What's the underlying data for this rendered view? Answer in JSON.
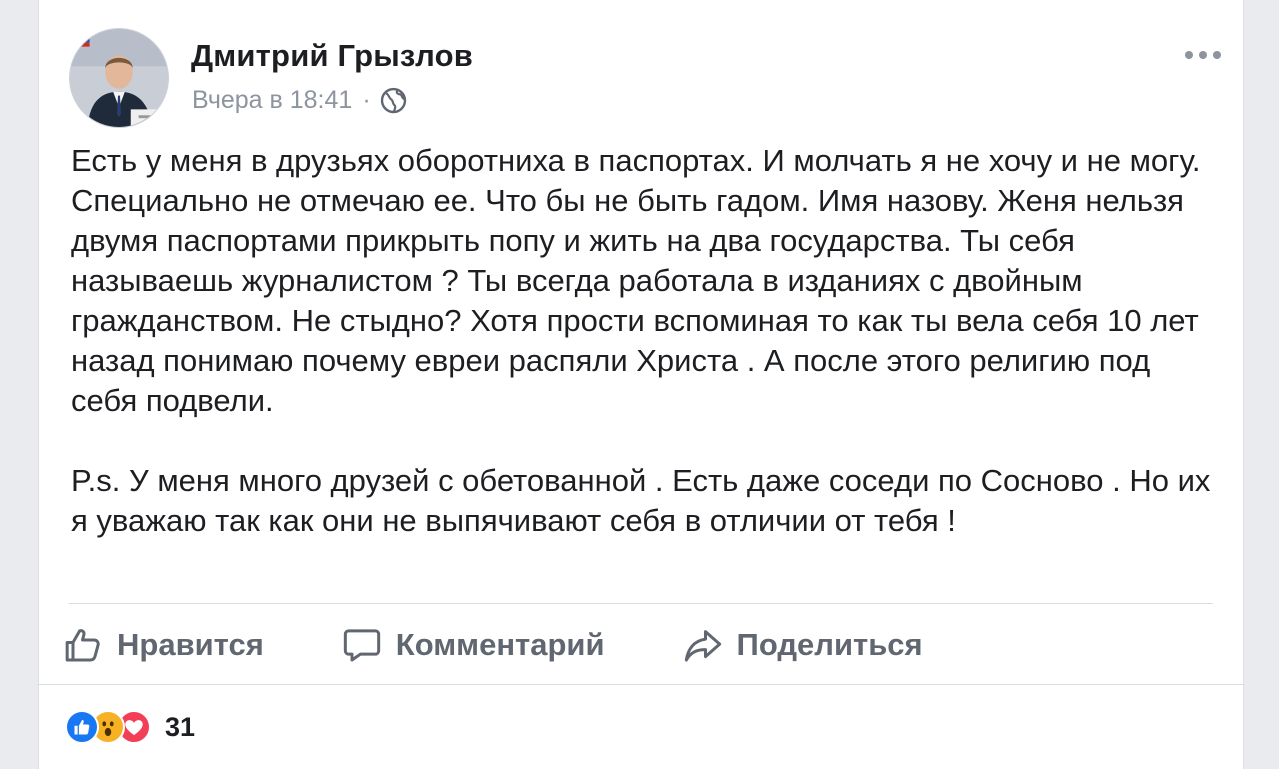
{
  "post": {
    "author": "Дмитрий Грызлов",
    "time": "Вчера в 18:41",
    "separator": "·",
    "privacy_icon": "globe-icon",
    "paragraphs": [
      "Есть у меня в друзьях оборотниха в паспортах. И молчать я не хочу и не могу. Специально не отмечаю ее. Что бы не быть гадом. Имя назову. Женя нельзя двумя паспортами прикрыть попу и жить на два государства. Ты себя называешь журналистом ? Ты всегда работала в изданиях с двойным гражданством. Не стыдно? Хотя прости вспоминая то как ты вела себя 10 лет назад понимаю почему евреи распяли Христа . А после этого религию под себя подвели.",
      "P.s. У меня много друзей с обетованной . Есть даже соседи по Сосново . Но их я уважаю так как они не выпячивают себя в отличии от тебя !"
    ]
  },
  "actions": {
    "like_label": "Нравится",
    "comment_label": "Комментарий",
    "share_label": "Поделиться"
  },
  "reactions": {
    "count": "31",
    "types": [
      "like-icon",
      "wow-icon",
      "love-icon"
    ]
  },
  "colors": {
    "like_blue": "#1877f2",
    "wow_yellow": "#f7b125",
    "love_red": "#f33e58",
    "muted_text": "#606770"
  }
}
